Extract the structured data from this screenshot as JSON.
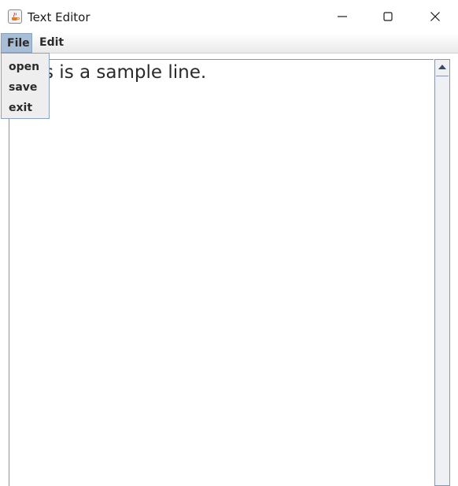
{
  "window": {
    "title": "Text Editor",
    "icon": "java-coffee-icon"
  },
  "controls": {
    "minimize_icon": "minimize-icon",
    "maximize_icon": "maximize-icon",
    "close_icon": "close-icon"
  },
  "menubar": {
    "items": [
      {
        "label": "File",
        "open": true
      },
      {
        "label": "Edit",
        "open": false
      }
    ]
  },
  "file_menu": {
    "items": [
      {
        "label": "open"
      },
      {
        "label": "save"
      },
      {
        "label": "exit"
      }
    ]
  },
  "editor": {
    "content": "This is a sample line."
  },
  "colors": {
    "menu_selected": "#a8bdd6",
    "dropdown_bg": "#eeeeee",
    "border_accent": "#8a96a8"
  }
}
